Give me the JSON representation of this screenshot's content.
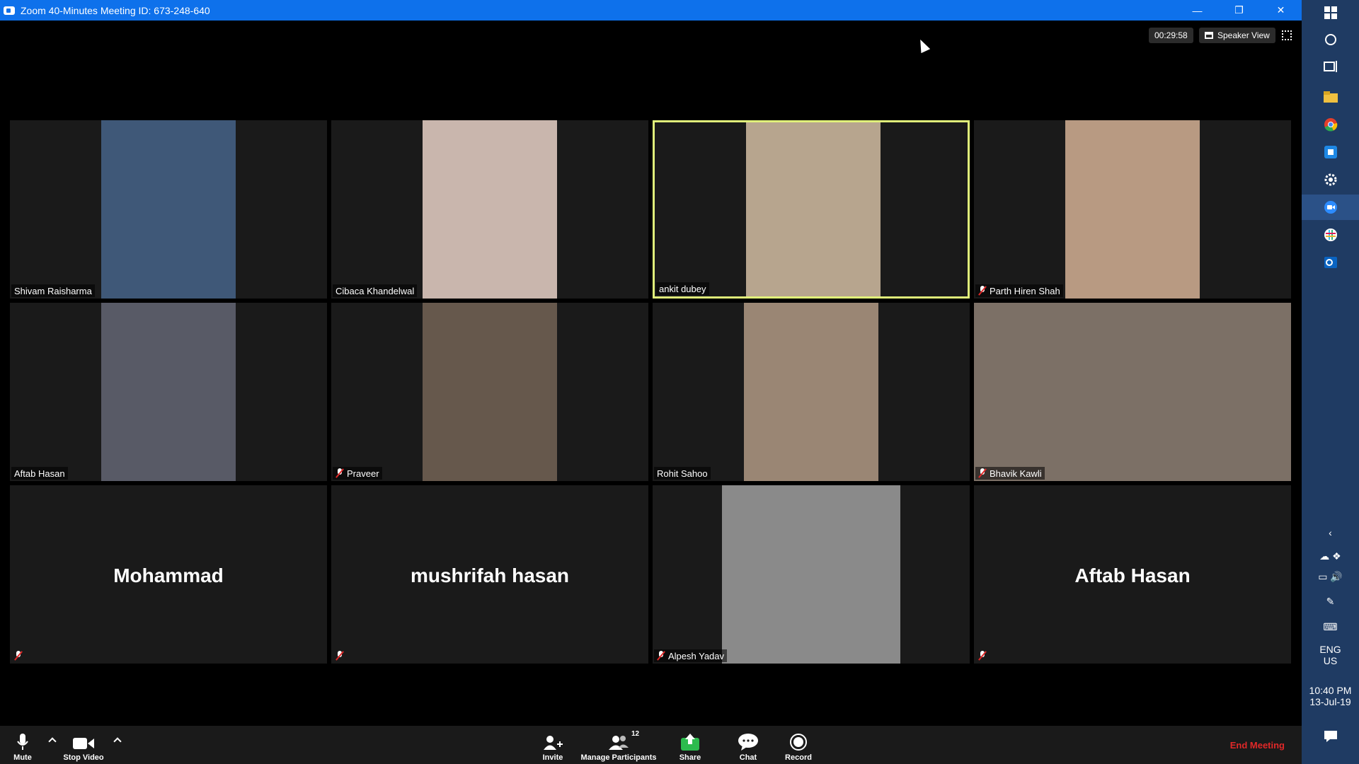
{
  "window": {
    "title": "Zoom 40-Minutes Meeting ID: 673-248-640",
    "controls": [
      "minimize-icon",
      "restore-icon",
      "close-icon"
    ]
  },
  "meeting": {
    "timer": "00:29:58",
    "view_button": "Speaker View"
  },
  "participants": [
    {
      "name": "Shivam Raisharma",
      "muted": false,
      "video": true,
      "video_color": "#3f5878"
    },
    {
      "name": "Cibaca Khandelwal",
      "muted": false,
      "video": true,
      "video_color": "#c9b6ad"
    },
    {
      "name": "ankit dubey",
      "muted": false,
      "video": true,
      "video_color": "#b7a58e",
      "active_speaker": true
    },
    {
      "name": "Parth Hiren Shah",
      "muted": true,
      "video": true,
      "video_color": "#b89a82"
    },
    {
      "name": "Aftab Hasan",
      "muted": false,
      "video": true,
      "video_color": "#585a66"
    },
    {
      "name": "Praveer",
      "muted": true,
      "video": true,
      "video_color": "#66584c"
    },
    {
      "name": "Rohit Sahoo",
      "muted": false,
      "video": true,
      "video_color": "#9a8674"
    },
    {
      "name": "Bhavik Kawli",
      "muted": true,
      "video": true,
      "video_color": "#7c7066"
    },
    {
      "name": "Mohammad",
      "muted": true,
      "video": false
    },
    {
      "name": "mushrifah hasan",
      "muted": true,
      "video": false
    },
    {
      "name": "Alpesh Yadav",
      "muted": true,
      "video": true,
      "video_color": "#8a8a8a"
    },
    {
      "name": "Aftab Hasan",
      "muted": true,
      "video": false
    }
  ],
  "toolbar": {
    "mute": "Mute",
    "stop_video": "Stop Video",
    "invite": "Invite",
    "manage_participants": "Manage Participants",
    "participant_count": "12",
    "share": "Share",
    "chat": "Chat",
    "record": "Record",
    "end_meeting": "End Meeting"
  },
  "colors": {
    "title_bar": "#0e71eb",
    "active_border": "#e0f07a",
    "end_meeting": "#e02828",
    "share_green": "#2dbb4e",
    "taskbar": "#1f3b63"
  },
  "taskbar": {
    "icons": [
      "windows-icon",
      "cortana-icon",
      "task-view-icon",
      "file-explorer-icon",
      "chrome-icon",
      "app-icon",
      "settings-icon",
      "zoom-icon",
      "slack-icon",
      "outlook-icon"
    ],
    "tray_icons": [
      "chevron-left-icon",
      "onedrive-icon",
      "dropbox-icon",
      "battery-icon",
      "volume-icon",
      "pen-icon",
      "keyboard-icon"
    ],
    "language_line1": "ENG",
    "language_line2": "US",
    "time": "10:40 PM",
    "date": "13-Jul-19"
  }
}
